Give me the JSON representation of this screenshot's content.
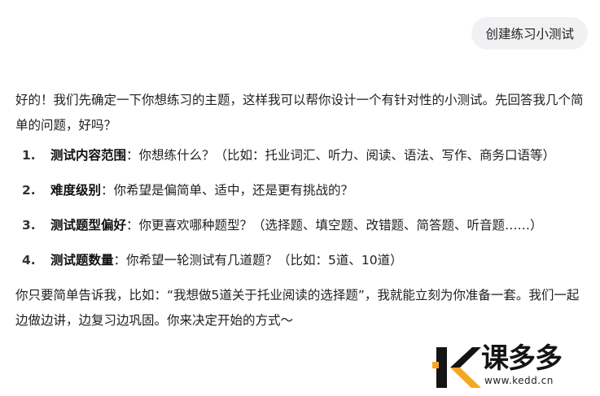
{
  "user_message": "创建练习小测试",
  "reply": {
    "intro": "好的！我们先确定一下你想练习的主题，这样我可以帮你设计一个有针对性的小测试。先回答我几个简单的问题，好吗？",
    "items": [
      {
        "num": "1.",
        "title": "测试内容范围",
        "text": "：你想练什么？（比如：托业词汇、听力、阅读、语法、写作、商务口语等）"
      },
      {
        "num": "2.",
        "title": "难度级别",
        "text": "：你希望是偏简单、适中，还是更有挑战的？"
      },
      {
        "num": "3.",
        "title": "测试题型偏好",
        "text": "：你更喜欢哪种题型？（选择题、填空题、改错题、简答题、听音题……）"
      },
      {
        "num": "4.",
        "title": "测试题数量",
        "text": "：你希望一轮测试有几道题？（比如：5道、10道）"
      }
    ],
    "outro": "你只要简单告诉我，比如：“我想做5道关于托业阅读的选择题”，我就能立刻为你准备一套。我们一起边做边讲，边复习边巩固。你来决定开始的方式～"
  },
  "watermark": {
    "name": "课多多",
    "url": "www.kedd.cn",
    "accent": "#f5a623"
  }
}
